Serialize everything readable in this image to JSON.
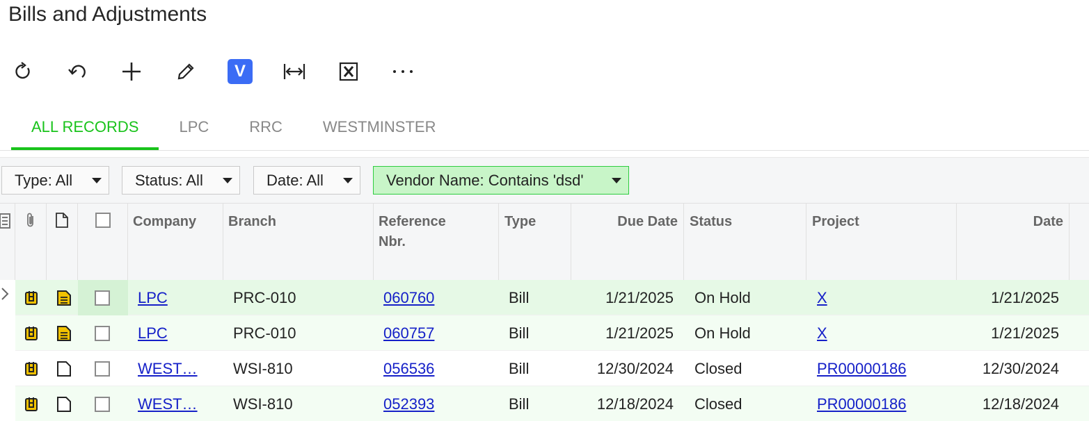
{
  "page": {
    "title": "Bills and Adjustments"
  },
  "toolbar": [
    {
      "name": "refresh-icon"
    },
    {
      "name": "undo-icon"
    },
    {
      "name": "add-icon"
    },
    {
      "name": "edit-icon"
    },
    {
      "name": "v-icon",
      "label": "V",
      "color": "#3b6cf5"
    },
    {
      "name": "fit-width-icon"
    },
    {
      "name": "excel-icon"
    },
    {
      "name": "more-icon"
    }
  ],
  "tabs": [
    "ALL RECORDS",
    "LPC",
    "RRC",
    "WESTMINSTER"
  ],
  "filters": [
    {
      "label": "Type: All"
    },
    {
      "label": "Status: All"
    },
    {
      "label": "Date: All"
    },
    {
      "label": "Vendor Name: Contains 'dsd'"
    }
  ],
  "columns": {
    "company": "Company",
    "branch": "Branch",
    "reference_line1": "Reference",
    "reference_line2": "Nbr.",
    "type": "Type",
    "due_date": "Due Date",
    "status": "Status",
    "project": "Project",
    "date": "Date"
  },
  "rows": [
    {
      "company": "LPC",
      "branch": "PRC-010",
      "reference": "060760",
      "type": "Bill",
      "due_date": "1/21/2025",
      "status": "On Hold",
      "project": "X",
      "date": "1/21/2025",
      "has_note": true
    },
    {
      "company": "LPC",
      "branch": "PRC-010",
      "reference": "060757",
      "type": "Bill",
      "due_date": "1/21/2025",
      "status": "On Hold",
      "project": "X",
      "date": "1/21/2025",
      "has_note": true
    },
    {
      "company": "WEST…",
      "branch": "WSI-810",
      "reference": "056536",
      "type": "Bill",
      "due_date": "12/30/2024",
      "status": "Closed",
      "project": "PR00000186",
      "date": "12/30/2024",
      "has_note": false
    },
    {
      "company": "WEST…",
      "branch": "WSI-810",
      "reference": "052393",
      "type": "Bill",
      "due_date": "12/18/2024",
      "status": "Closed",
      "project": "PR00000186",
      "date": "12/18/2024",
      "has_note": false
    }
  ],
  "colors": {
    "accent": "#19c31b",
    "link": "#1520c8",
    "file_icon": "#f2c200"
  }
}
